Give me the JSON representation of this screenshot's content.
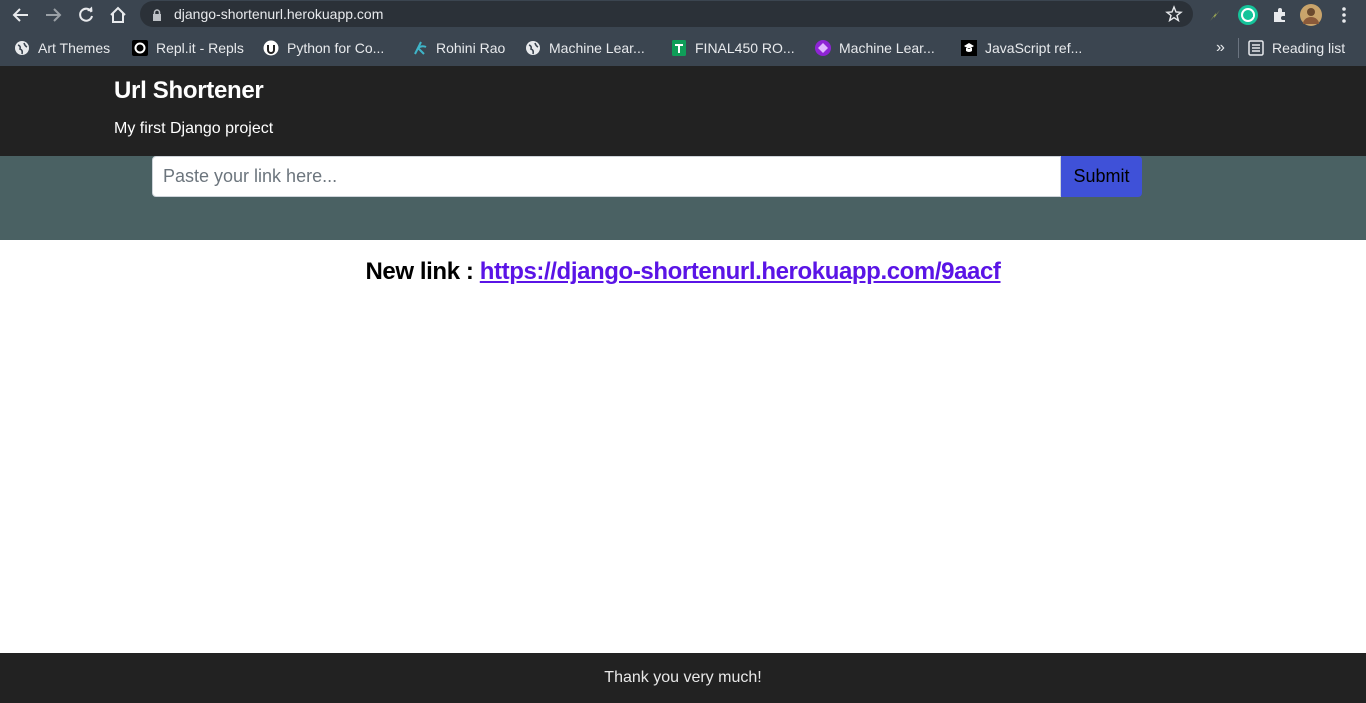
{
  "browser": {
    "url": "django-shortenurl.herokuapp.com",
    "bookmarks": [
      {
        "label": "Art Themes",
        "icon": "globe-icon"
      },
      {
        "label": "Repl.it - Repls",
        "icon": "replit-icon"
      },
      {
        "label": "Python for Co...",
        "icon": "python-for-co-icon"
      },
      {
        "label": "Rohini Rao",
        "icon": "rohini-rao-icon"
      },
      {
        "label": "Machine Lear...",
        "icon": "globe-icon"
      },
      {
        "label": "FINAL450 RO...",
        "icon": "sheets-icon"
      },
      {
        "label": "Machine Lear...",
        "icon": "purple-diamond-icon"
      },
      {
        "label": "JavaScript ref...",
        "icon": "js-ref-icon"
      }
    ],
    "overflow_label": "»",
    "reading_list_label": "Reading list"
  },
  "header": {
    "title": "Url Shortener",
    "subtitle": "My first Django project"
  },
  "form": {
    "placeholder": "Paste your link here...",
    "value": "",
    "submit_label": "Submit"
  },
  "result": {
    "prefix": "New link : ",
    "link": "https://django-shortenurl.herokuapp.com/9aacf"
  },
  "footer": {
    "text": "Thank you very much!"
  },
  "colors": {
    "header_bg": "#222222",
    "form_band_bg": "#4a6163",
    "submit_bg": "#3f51d8",
    "link_color": "#5a14e6"
  }
}
